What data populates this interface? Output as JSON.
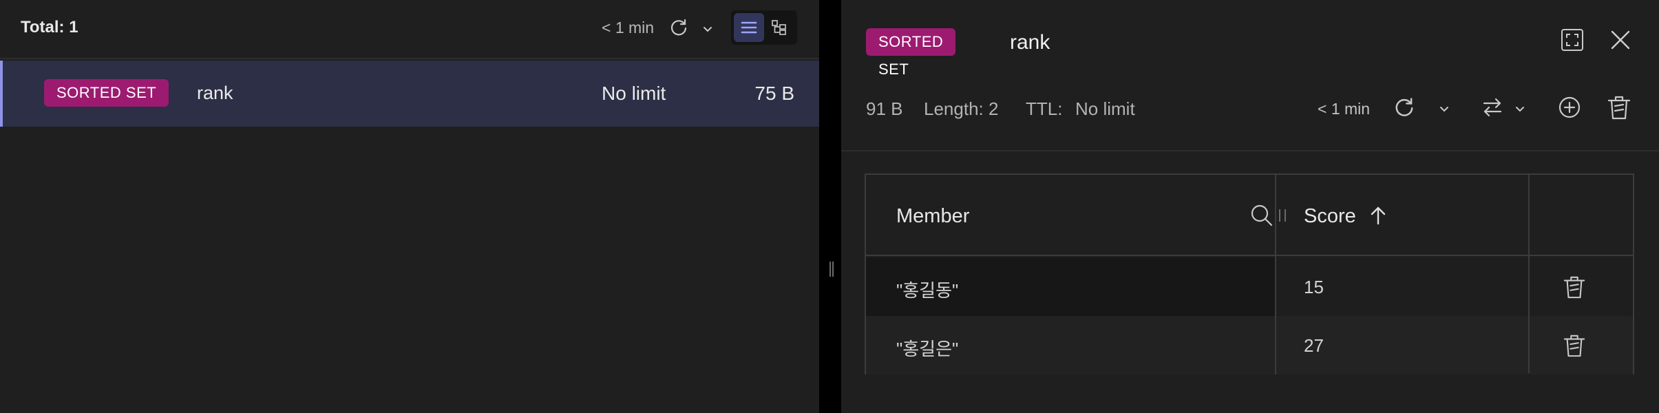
{
  "list": {
    "total": "Total: 1",
    "last_refresh": "< 1 min",
    "rows": [
      {
        "type": "SORTED SET",
        "name": "rank",
        "ttl": "No limit",
        "size": "75 B"
      }
    ]
  },
  "detail": {
    "type": "SORTED SET",
    "name": "rank",
    "size": "91 B",
    "length": "Length: 2",
    "ttl_label": "TTL:",
    "ttl_value": "No limit",
    "last_refresh": "< 1 min",
    "table": {
      "headers": {
        "member": "Member",
        "score": "Score"
      },
      "sort": "ascending",
      "rows": [
        {
          "member": "\"홍길동\"",
          "score": "15"
        },
        {
          "member": "\"홍길은\"",
          "score": "27"
        }
      ]
    }
  },
  "icons": {
    "refresh": "refresh-icon",
    "chevron": "chevron-down-icon",
    "list_view": "list-view-icon",
    "tree_view": "tree-view-icon",
    "expand": "expand-icon",
    "close": "close-icon",
    "swap": "swap-icon",
    "add": "add-circle-icon",
    "delete": "trash-icon",
    "search": "search-icon",
    "sort": "arrow-up-icon"
  },
  "colors": {
    "badge_sorted_set": "#9c1b70",
    "selected_row": "#2c2f45",
    "accent": "#8c93e6"
  }
}
